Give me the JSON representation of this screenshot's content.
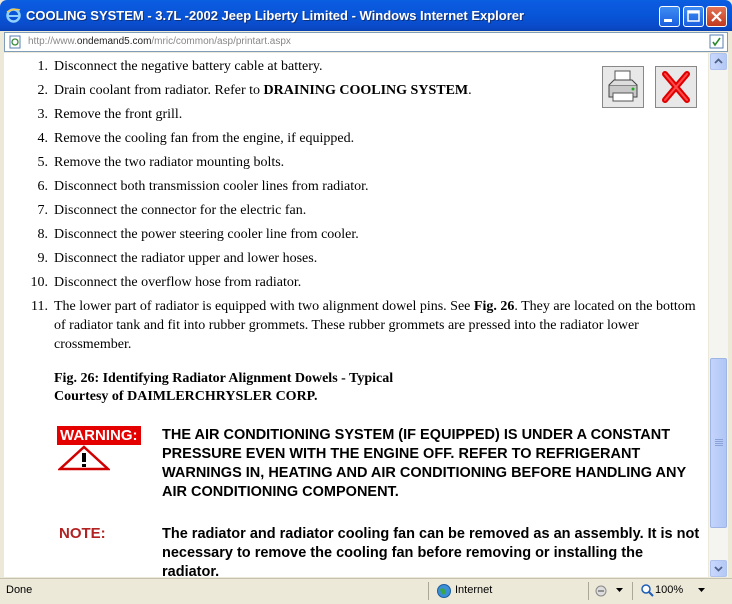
{
  "window": {
    "title": "COOLING SYSTEM - 3.7L -2002 Jeep Liberty Limited - Windows Internet Explorer"
  },
  "address": {
    "url_prefix": "http://www.",
    "url_domain": "ondemand5.com",
    "url_path": "/mric/common/asp/printart.aspx"
  },
  "steps": [
    {
      "num": "1.",
      "text": "Disconnect the negative battery cable at battery."
    },
    {
      "num": "2.",
      "text": "Drain coolant from radiator. Refer to ",
      "bold": "DRAINING COOLING SYSTEM",
      "after": "."
    },
    {
      "num": "3.",
      "text": "Remove the front grill."
    },
    {
      "num": "4.",
      "text": "Remove the cooling fan from the engine, if equipped."
    },
    {
      "num": "5.",
      "text": "Remove the two radiator mounting bolts."
    },
    {
      "num": "6.",
      "text": "Disconnect both transmission cooler lines from radiator."
    },
    {
      "num": "7.",
      "text": "Disconnect the connector for the electric fan."
    },
    {
      "num": "8.",
      "text": "Disconnect the power steering cooler line from cooler."
    },
    {
      "num": "9.",
      "text": "Disconnect the radiator upper and lower hoses."
    },
    {
      "num": "10.",
      "text": "Disconnect the overflow hose from radiator."
    },
    {
      "num": "11.",
      "text": "The lower part of radiator is equipped with two alignment dowel pins. See ",
      "bold": "Fig. 26",
      "after": ". They are located on the bottom of radiator tank and fit into rubber grommets. These rubber grommets are pressed into the radiator lower crossmember."
    }
  ],
  "figure": {
    "caption": "Fig. 26: Identifying Radiator Alignment Dowels - Typical",
    "courtesy": "Courtesy of DAIMLERCHRYSLER CORP."
  },
  "warning": {
    "label": "WARNING:",
    "text": "THE AIR CONDITIONING SYSTEM (IF EQUIPPED) IS UNDER A CONSTANT PRESSURE EVEN WITH THE ENGINE OFF. REFER TO REFRIGERANT WARNINGS IN, HEATING AND AIR CONDITIONING BEFORE HANDLING ANY AIR CONDITIONING COMPONENT."
  },
  "note": {
    "label": "NOTE:",
    "text": "The radiator and radiator cooling fan can be removed as an assembly. It is not necessary to remove the cooling fan before removing or installing the radiator."
  },
  "status": {
    "left": "Done",
    "zone": "Internet",
    "zoom": "100%"
  },
  "colors": {
    "titlebar": "#0855d8",
    "warning_bg": "#e50000",
    "note_label": "#b22222"
  }
}
